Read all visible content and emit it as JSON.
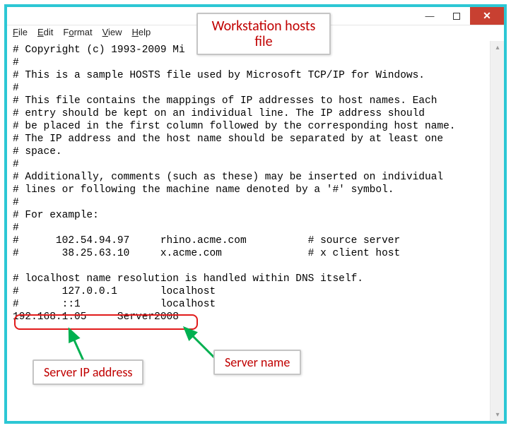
{
  "window": {
    "minimize_glyph": "—",
    "close_glyph": "✕"
  },
  "menu": {
    "file": "File",
    "edit": "Edit",
    "format": "Format",
    "view": "View",
    "help": "Help"
  },
  "file_text": "# Copyright (c) 1993-2009 Mi\n#\n# This is a sample HOSTS file used by Microsoft TCP/IP for Windows.\n#\n# This file contains the mappings of IP addresses to host names. Each\n# entry should be kept on an individual line. The IP address should\n# be placed in the first column followed by the corresponding host name.\n# The IP address and the host name should be separated by at least one\n# space.\n#\n# Additionally, comments (such as these) may be inserted on individual\n# lines or following the machine name denoted by a '#' symbol.\n#\n# For example:\n#\n#      102.54.94.97     rhino.acme.com          # source server\n#       38.25.63.10     x.acme.com              # x client host\n\n# localhost name resolution is handled within DNS itself.\n#       127.0.0.1       localhost\n#       ::1             localhost\n192.168.1.05     Server2008",
  "annotations": {
    "title": "Workstation hosts file",
    "server_ip_label": "Server IP address",
    "server_name_label": "Server name"
  },
  "highlighted": {
    "server_ip": "192.168.1.05",
    "server_name": "Server2008"
  },
  "scrollbar": {
    "up_glyph": "▴",
    "down_glyph": "▾"
  }
}
